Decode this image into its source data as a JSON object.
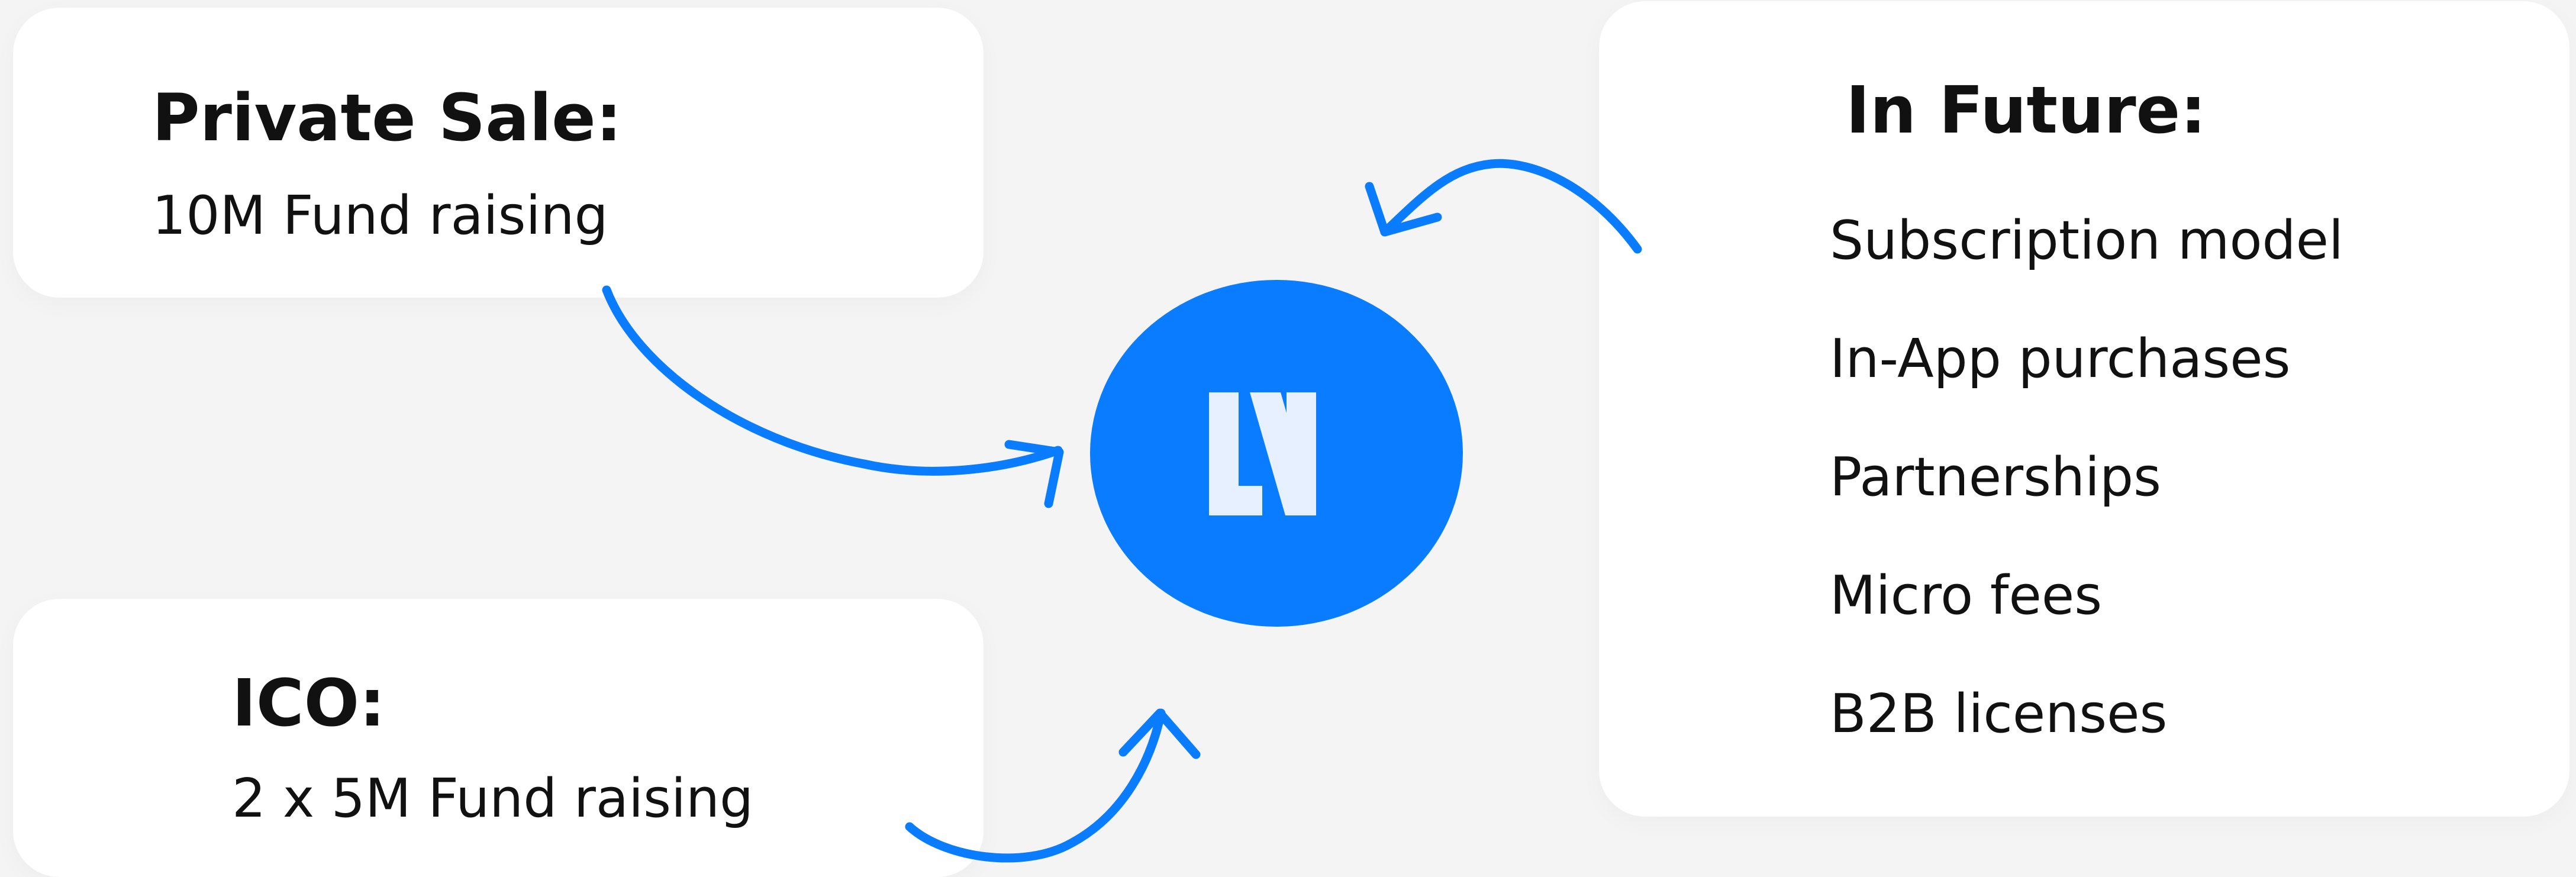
{
  "private_sale": {
    "title": "Private Sale:",
    "description": "10M Fund raising"
  },
  "ico": {
    "title": "ICO:",
    "description": "2 x 5M Fund raising"
  },
  "in_future": {
    "title": "In Future:",
    "items": [
      "Subscription model",
      "In-App purchases",
      "Partnerships",
      "Micro fees",
      "B2B licenses"
    ]
  },
  "logo": {
    "text": "LN",
    "icon": "ln-logo-icon"
  },
  "colors": {
    "accent": "#0a7cff",
    "logo_mark": "#e6f0ff",
    "card": "#ffffff",
    "background": "#f4f4f4",
    "text": "#111111"
  }
}
